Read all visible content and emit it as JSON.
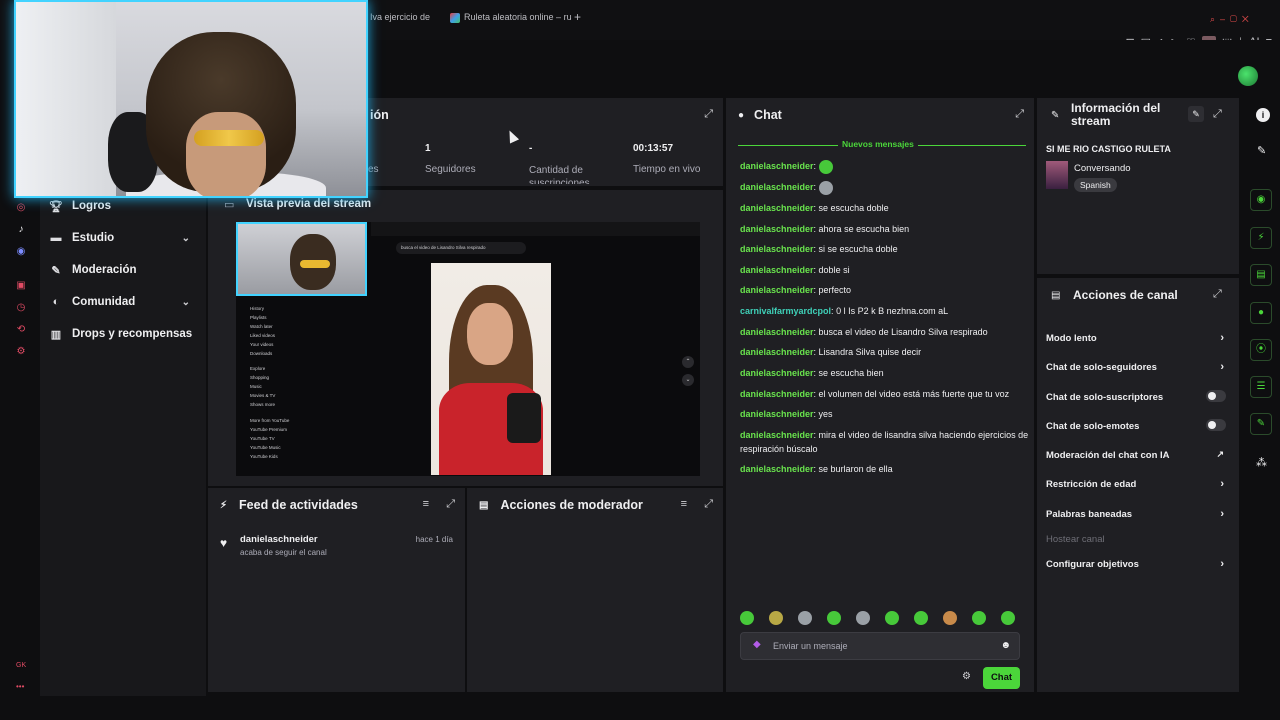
{
  "browser": {
    "tab1": "Iva ejercicio de",
    "tab2": "Ruleta aleatoria online – ru",
    "new_tab": "+",
    "ext_label": "AI"
  },
  "sidebar": {
    "items": [
      {
        "label": "Logros",
        "icon": "trophy-icon"
      },
      {
        "label": "Estudio",
        "icon": "studio-icon",
        "chevron": true
      },
      {
        "label": "Moderación",
        "icon": "wrench-icon"
      },
      {
        "label": "Comunidad",
        "icon": "community-icon",
        "chevron": true
      },
      {
        "label": "Drops y recompensas",
        "icon": "drops-icon"
      }
    ],
    "footer": "GK"
  },
  "session": {
    "title_tail": "ión",
    "stats": [
      {
        "value": "1",
        "label": "Seguidores"
      },
      {
        "value": "-",
        "label": "Cantidad de suscripciones"
      },
      {
        "value": "00:13:57",
        "label": "Tiempo en vivo"
      }
    ],
    "hidden_label": "es"
  },
  "preview": {
    "title": "Vista previa del stream",
    "search_text": "busca el video de Lisandro Silva respirado",
    "yt_items": [
      "History",
      "Playlists",
      "Watch later",
      "Liked videos",
      "Your videos",
      "Downloads",
      "Explore",
      "Shopping",
      "Music",
      "Movies & TV",
      "Shows more",
      "More from YouTube",
      "YouTube Premium",
      "YouTube TV",
      "YouTube Music",
      "YouTube Kids"
    ]
  },
  "activity": {
    "title": "Feed de actividades",
    "items": [
      {
        "user": "danielaschneider",
        "action": "acaba de seguir el canal",
        "time": "hace 1 día"
      }
    ]
  },
  "mod_actions": {
    "title": "Acciones de moderador"
  },
  "chat": {
    "title": "Chat",
    "new_messages": "Nuevos mensajes",
    "messages": [
      {
        "user": "danielaschneider",
        "text": "",
        "emote": true
      },
      {
        "user": "danielaschneider",
        "text": "",
        "emote": true
      },
      {
        "user": "danielaschneider",
        "text": "se escucha doble"
      },
      {
        "user": "danielaschneider",
        "text": "ahora se escucha bien"
      },
      {
        "user": "danielaschneider",
        "text": "si se escucha doble"
      },
      {
        "user": "danielaschneider",
        "text": "doble si"
      },
      {
        "user": "danielaschneider",
        "text": "perfecto"
      },
      {
        "user": "carnivalfarmyardcpol",
        "text": "0 l Is P2 k B nezhna.com aL",
        "user_color": "#3fd0b8"
      },
      {
        "user": "danielaschneider",
        "text": "busca el video de Lisandro Silva respirado"
      },
      {
        "user": "danielaschneider",
        "text": "Lisandra Silva quise decir"
      },
      {
        "user": "danielaschneider",
        "text": "se escucha bien"
      },
      {
        "user": "danielaschneider",
        "text": "el volumen del video está más fuerte que tu voz"
      },
      {
        "user": "danielaschneider",
        "text": "yes"
      },
      {
        "user": "danielaschneider",
        "text": "mira el video de lisandra silva haciendo ejercicios de respiración búscalo"
      },
      {
        "user": "danielaschneider",
        "text": "se burlaron de ella"
      }
    ],
    "input_placeholder": "Enviar un mensaje",
    "send_label": "Chat"
  },
  "stream_info": {
    "title": "Información del stream",
    "stream_title": "SI ME RIO CASTIGO RULETA",
    "category": "Conversando",
    "language": "Spanish"
  },
  "channel_actions": {
    "title": "Acciones de canal",
    "items": [
      {
        "label": "Modo lento",
        "control": "chevron"
      },
      {
        "label": "Chat de solo-seguidores",
        "control": "chevron"
      },
      {
        "label": "Chat de solo-suscriptores",
        "control": "toggle"
      },
      {
        "label": "Chat de solo-emotes",
        "control": "toggle"
      },
      {
        "label": "Moderación del chat con IA",
        "control": "external"
      },
      {
        "label": "Restricción de edad",
        "control": "chevron"
      },
      {
        "label": "Palabras baneadas",
        "control": "chevron"
      },
      {
        "label": "Hostear canal",
        "control": "disabled"
      },
      {
        "label": "Configurar objetivos",
        "control": "chevron"
      }
    ]
  },
  "colors": {
    "accent": "#4bd63a",
    "panel": "#1f1f23",
    "sidebar": "#18181b",
    "username": "#69e34d",
    "webcam_border": "#42d3ff"
  }
}
